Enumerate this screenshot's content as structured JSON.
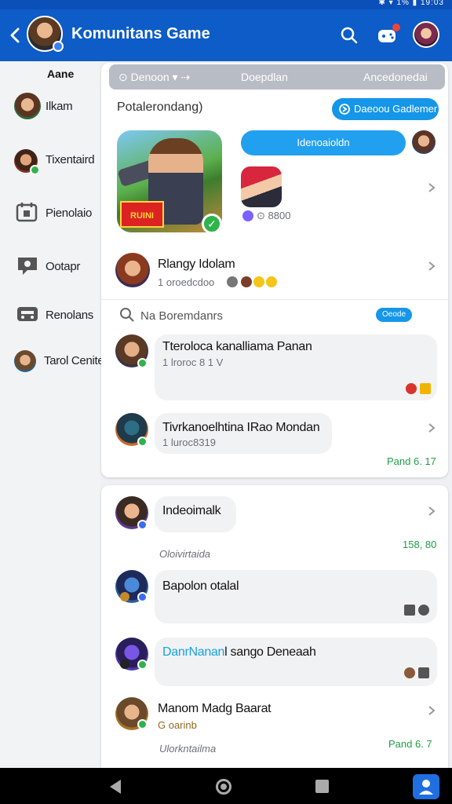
{
  "statusbar": {
    "right": "✱ ▾ 1% ▮ 19:03"
  },
  "appbar": {
    "title": "Komunitans Game",
    "colors": {
      "primary": "#0d5cc7",
      "accent": "#1596e8",
      "online": "#2fb34a"
    }
  },
  "sidebar": {
    "header": "Aane",
    "items": [
      {
        "label": "Ilkam",
        "icon": "avatar"
      },
      {
        "label": "Tixentaird",
        "icon": "avatar"
      },
      {
        "label": "Pienolaio",
        "icon": "calendar-icon"
      },
      {
        "label": "Ootapr",
        "icon": "chat-icon"
      },
      {
        "label": "Renolans",
        "icon": "gamepad-icon"
      },
      {
        "label": "Tarol Cenite",
        "icon": "avatar"
      }
    ]
  },
  "panel1": {
    "tabs": [
      "⊙ Denoon ▾ ⇢",
      "Doepdlan",
      "Ancedonedai"
    ],
    "section_title": "Potalerondang)",
    "action_button": "Daeoou Gadlemer",
    "blue_bubble": "Idenoaioldn",
    "game_logo_text": "RUINI",
    "game_meta": "⊙ 8800",
    "featured": {
      "name": "Rlangy Idolam",
      "sub": "1 oroedcdoo"
    },
    "search_label": "Na Boremdanrs",
    "toggle_label": "Oeode",
    "messages": [
      {
        "name": "Tteroloca kanalliama Panan",
        "sub": "1 lroroc 8 1 V"
      },
      {
        "name": "Tivrkanoelhtina IRao Mondan",
        "sub": "1 luroc8319",
        "time": "Pand 6. 17"
      }
    ]
  },
  "panel2": {
    "messages": [
      {
        "name": "Indeoimalk",
        "sub": "Oloivirtaida",
        "time": "158, 80"
      },
      {
        "name": "Bapolon otalal"
      },
      {
        "name_accent": "DanrNanan",
        "name": "l sango Deneaah"
      },
      {
        "name": "Manom Madg Baarat",
        "sub": "G oarinb",
        "sub2": "Ulorkntailma",
        "time": "Pand 6. 7"
      }
    ]
  }
}
